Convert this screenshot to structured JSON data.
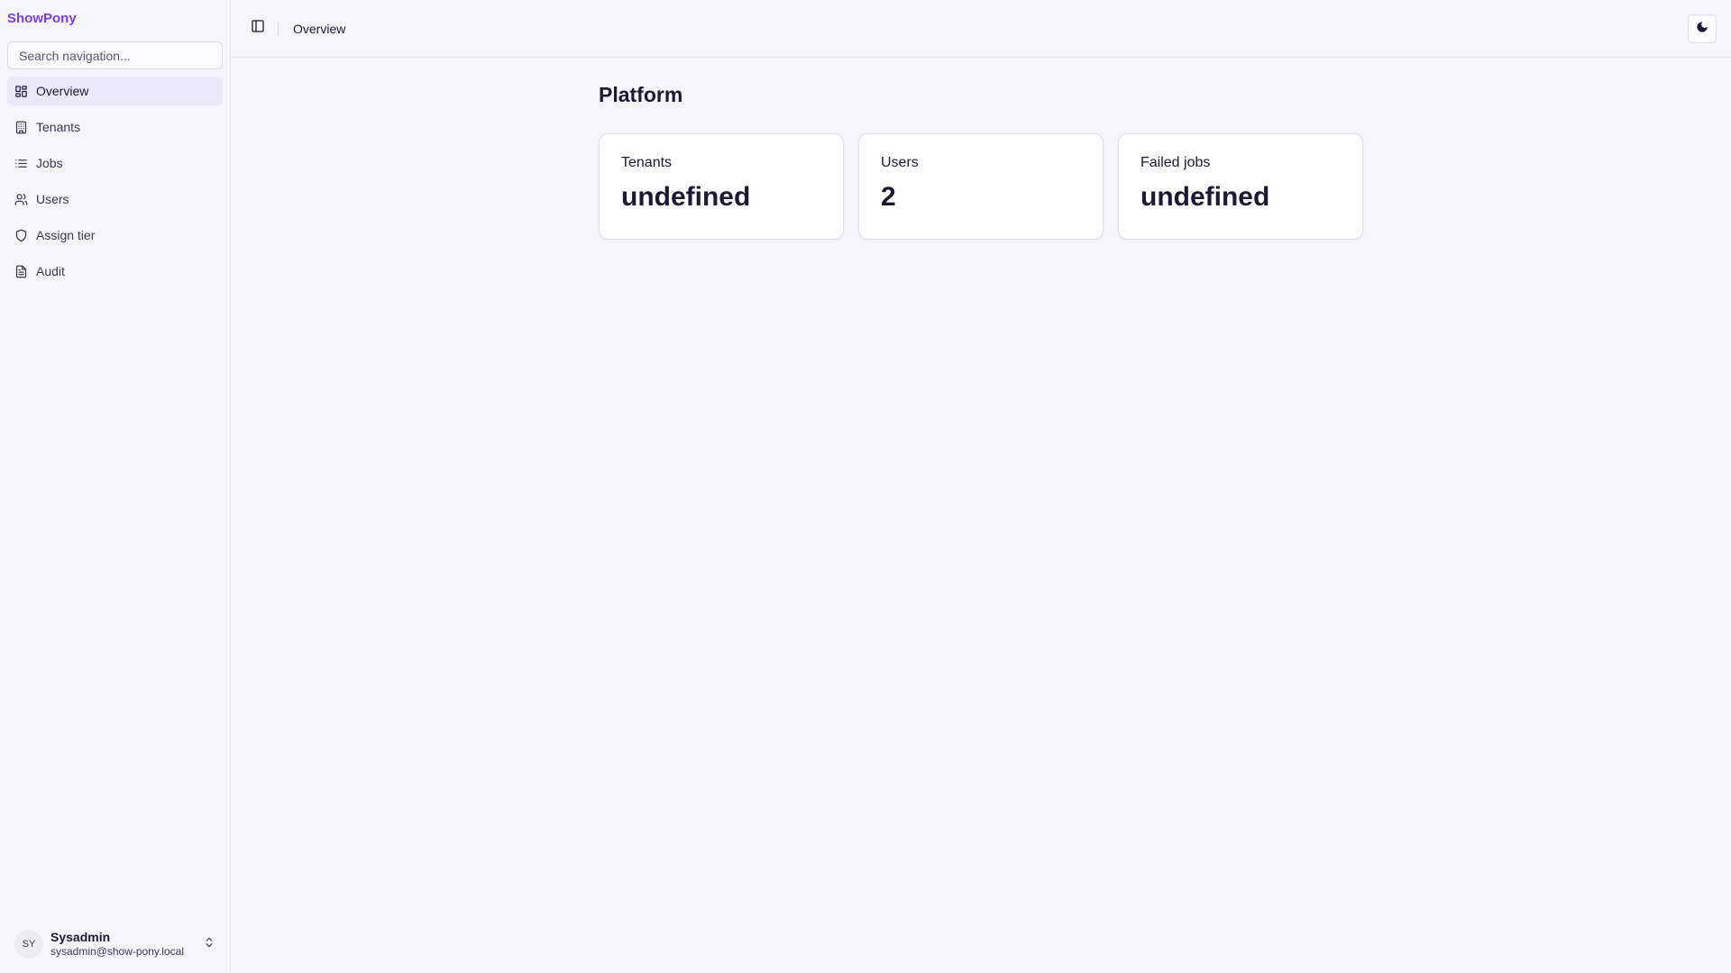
{
  "brand": "ShowPony",
  "search": {
    "placeholder": "Search navigation..."
  },
  "sidebar": {
    "items": [
      {
        "label": "Overview",
        "icon": "layout-grid-icon",
        "active": true
      },
      {
        "label": "Tenants",
        "icon": "building-icon"
      },
      {
        "label": "Jobs",
        "icon": "list-icon"
      },
      {
        "label": "Users",
        "icon": "users-icon"
      },
      {
        "label": "Assign tier",
        "icon": "shield-icon"
      },
      {
        "label": "Audit",
        "icon": "file-text-icon"
      }
    ]
  },
  "user": {
    "initials": "SY",
    "name": "Sysadmin",
    "email": "sysadmin@show-pony.local"
  },
  "header": {
    "breadcrumb": "Overview"
  },
  "main": {
    "title": "Platform",
    "cards": [
      {
        "label": "Tenants",
        "value": "undefined"
      },
      {
        "label": "Users",
        "value": "2"
      },
      {
        "label": "Failed jobs",
        "value": "undefined"
      }
    ]
  },
  "colors": {
    "brand": "#7c3aed",
    "background": "#f6f5fe",
    "active_nav": "#ebe9fb"
  }
}
